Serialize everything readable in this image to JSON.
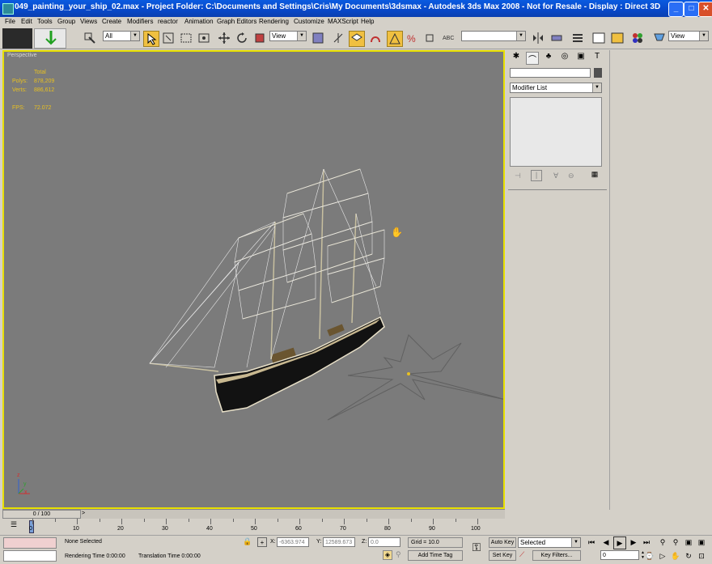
{
  "window": {
    "title": "049_painting_your_ship_02.max    - Project Folder: C:\\Documents and Settings\\Cris\\My Documents\\3dsmax    - Autodesk 3ds Max 2008    - Not for Resale    - Display : Direct 3D",
    "minimize": "_",
    "maximize": "□",
    "close": "✕"
  },
  "menu": [
    "File",
    "Edit",
    "Tools",
    "Group",
    "Views",
    "Create",
    "Modifiers",
    "reactor",
    "Animation",
    "Graph Editors",
    "Rendering",
    "Customize",
    "MAXScript",
    "Help"
  ],
  "toolbar": {
    "selection_filter": "All",
    "ref_coord": "View",
    "named_selection": "",
    "view_dropdown": "View"
  },
  "viewport": {
    "label": "Perspective",
    "stats": {
      "total_label": "Total",
      "polys_label": "Polys:",
      "polys_value": "878,209",
      "verts_label": "Verts:",
      "verts_value": "886,612",
      "fps_label": "FPS:",
      "fps_value": "72.072"
    },
    "axis": {
      "x": "x",
      "y": "y",
      "z": "z"
    }
  },
  "command_panel": {
    "tabs": [
      "create-icon",
      "modify-icon",
      "hierarchy-icon",
      "motion-icon",
      "display-icon",
      "utilities-icon"
    ],
    "name_field": "",
    "modifier_list": "Modifier List"
  },
  "timeline": {
    "frame_display": "0 / 100",
    "ticks": [
      "0",
      "10",
      "20",
      "30",
      "40",
      "50",
      "60",
      "70",
      "80",
      "90",
      "100"
    ]
  },
  "status": {
    "selection": "None Selected",
    "prompt": "Rendering Time  0:00:00",
    "translation": "Translation Time  0:00:00",
    "x_label": "X:",
    "x_value": "-6363.974",
    "y_label": "Y:",
    "y_value": "12589.673",
    "z_label": "Z:",
    "z_value": "0.0",
    "grid": "Grid = 10.0",
    "add_time_tag": "Add Time Tag",
    "auto_key": "Auto Key",
    "set_key": "Set Key",
    "key_mode": "Selected",
    "key_filters": "Key Filters...",
    "current_frame": "0"
  }
}
